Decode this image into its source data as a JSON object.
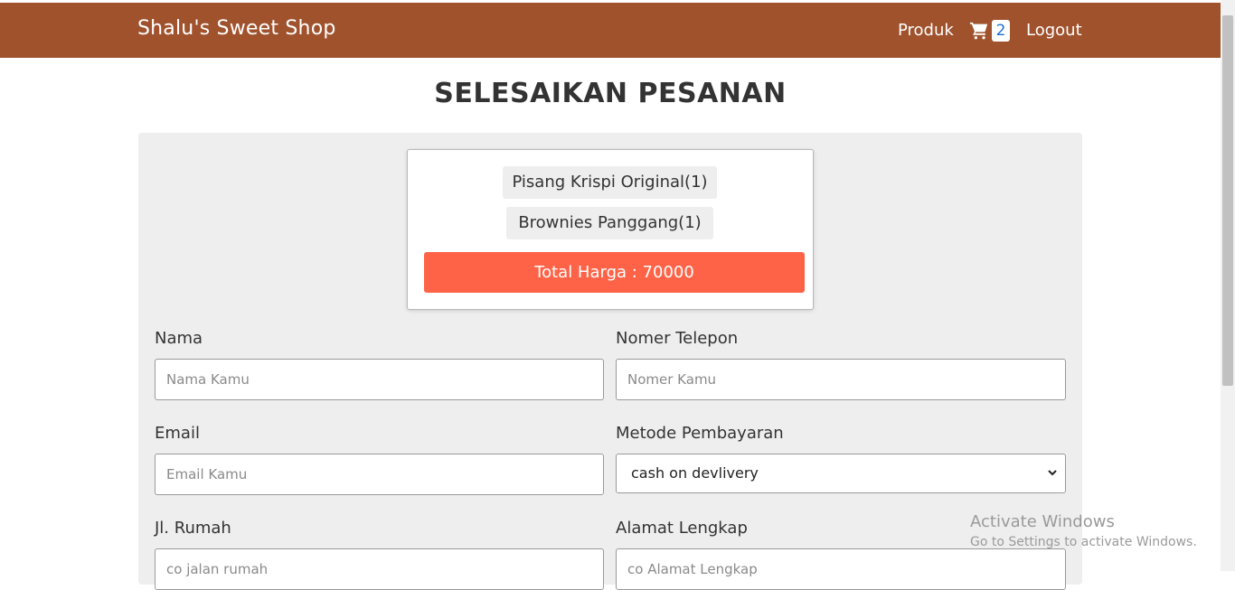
{
  "navbar": {
    "brand": "Shalu's Sweet Shop",
    "produk": "Produk",
    "cart_count": "2",
    "logout": "Logout",
    "color": "#a0522d"
  },
  "page": {
    "title": "SELESAIKAN PESANAN"
  },
  "summary": {
    "items": [
      "Pisang Krispi Original(1)",
      "Brownies Panggang(1)"
    ],
    "total": "Total Harga : 70000",
    "total_color": "#ff6347"
  },
  "form": {
    "nama_label": "Nama",
    "nama_placeholder": "Nama Kamu",
    "telepon_label": "Nomer Telepon",
    "telepon_placeholder": "Nomer Kamu",
    "email_label": "Email",
    "email_placeholder": "Email Kamu",
    "metode_label": "Metode Pembayaran",
    "metode_value": "cash on devlivery",
    "jalan_label": "Jl. Rumah",
    "jalan_placeholder": "co jalan rumah",
    "alamat_label": "Alamat Lengkap",
    "alamat_placeholder": "co Alamat Lengkap"
  },
  "watermark": {
    "line1": "Activate Windows",
    "line2": "Go to Settings to activate Windows."
  },
  "icons": {
    "cart": "cart-icon",
    "chevron": "chevron-down-icon"
  }
}
